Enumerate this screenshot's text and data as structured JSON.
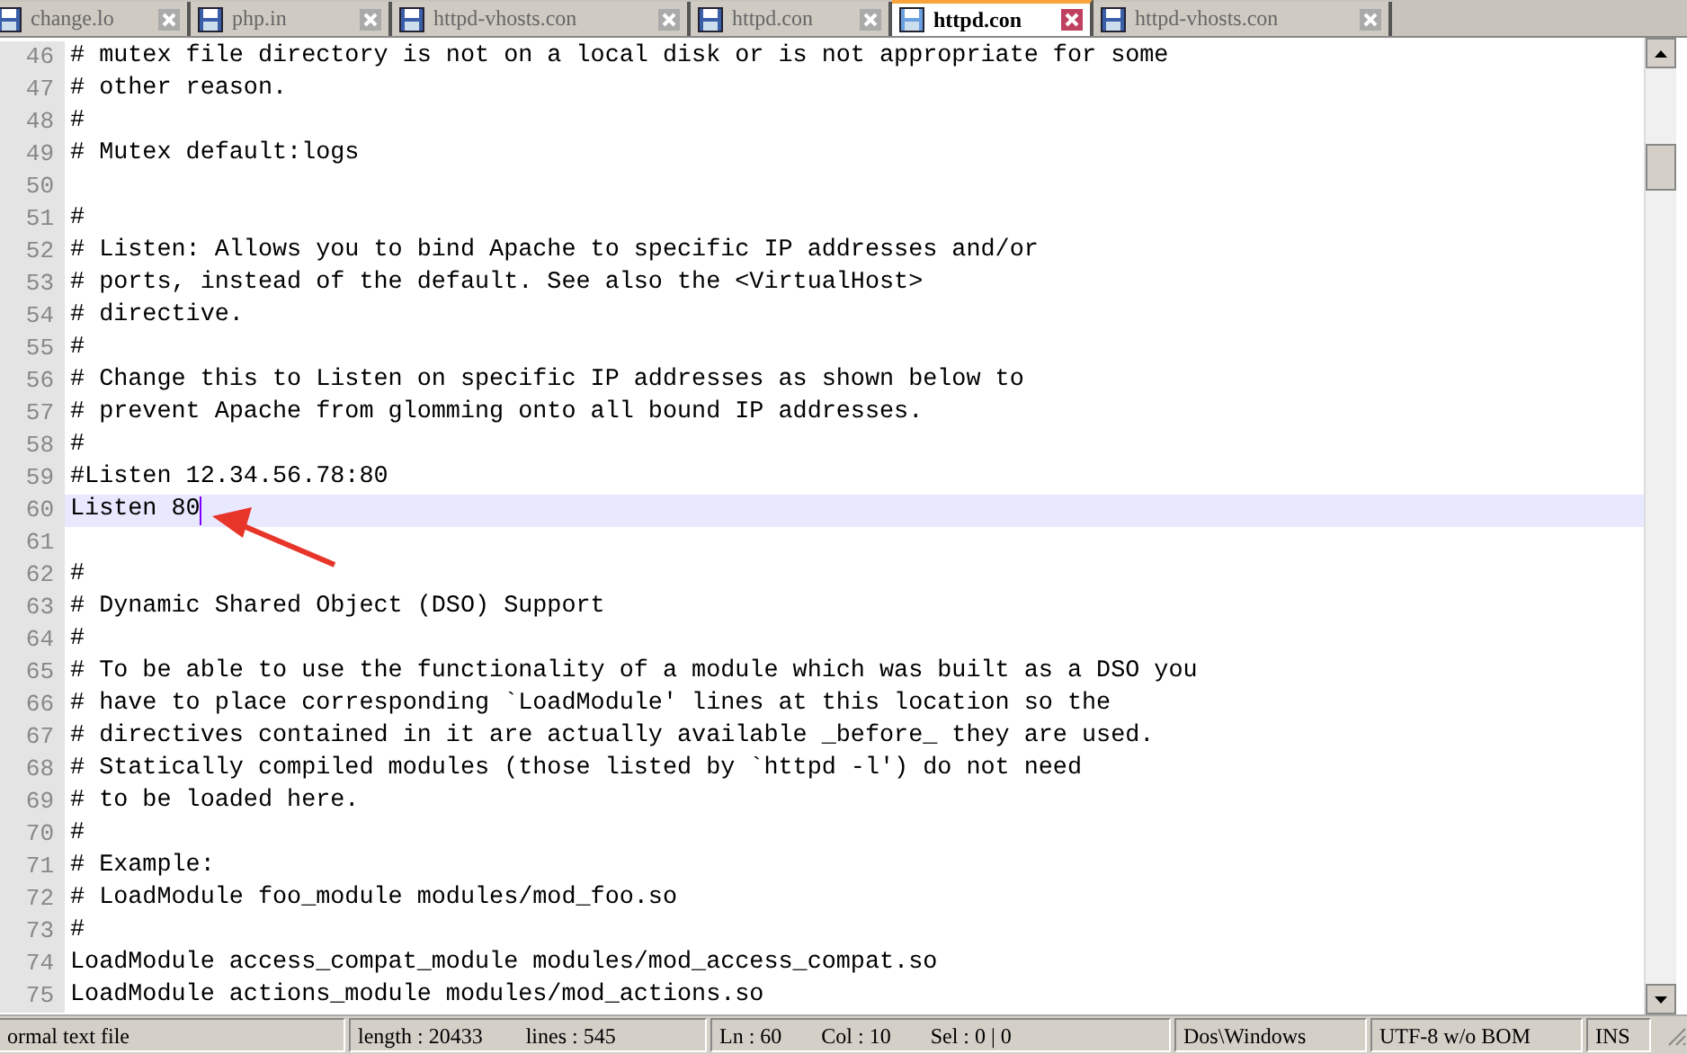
{
  "tabs": [
    {
      "label": "change.lo",
      "selected": false
    },
    {
      "label": "php.in",
      "selected": false
    },
    {
      "label": "httpd-vhosts.con",
      "selected": false
    },
    {
      "label": "httpd.con",
      "selected": false
    },
    {
      "label": "httpd.con",
      "selected": true
    },
    {
      "label": "httpd-vhosts.con",
      "selected": false
    }
  ],
  "editor": {
    "lines": [
      {
        "number": "46",
        "text": "# mutex file directory is not on a local disk or is not appropriate for some",
        "current": false
      },
      {
        "number": "47",
        "text": "# other reason.",
        "current": false
      },
      {
        "number": "48",
        "text": "#",
        "current": false
      },
      {
        "number": "49",
        "text": "# Mutex default:logs",
        "current": false
      },
      {
        "number": "50",
        "current": false
      },
      {
        "number": "51",
        "text": "#",
        "current": false
      },
      {
        "number": "52",
        "text": "# Listen: Allows you to bind Apache to specific IP addresses and/or",
        "current": false
      },
      {
        "number": "53",
        "text": "# ports, instead of the default. See also the <VirtualHost>",
        "current": false
      },
      {
        "number": "54",
        "text": "# directive.",
        "current": false
      },
      {
        "number": "55",
        "text": "#",
        "current": false
      },
      {
        "number": "56",
        "text": "# Change this to Listen on specific IP addresses as shown below to",
        "current": false
      },
      {
        "number": "57",
        "text": "# prevent Apache from glomming onto all bound IP addresses.",
        "current": false
      },
      {
        "number": "58",
        "text": "#",
        "current": false
      },
      {
        "number": "59",
        "text": "#Listen 12.34.56.78:80",
        "current": false
      },
      {
        "number": "60",
        "text": "Listen 80",
        "current": true
      },
      {
        "number": "61",
        "current": false
      },
      {
        "number": "62",
        "text": "#",
        "current": false
      },
      {
        "number": "63",
        "text": "# Dynamic Shared Object (DSO) Support",
        "current": false
      },
      {
        "number": "64",
        "text": "#",
        "current": false
      },
      {
        "number": "65",
        "text": "# To be able to use the functionality of a module which was built as a DSO you",
        "current": false
      },
      {
        "number": "66",
        "text": "# have to place corresponding `LoadModule' lines at this location so the",
        "current": false
      },
      {
        "number": "67",
        "text": "# directives contained in it are actually available _before_ they are used.",
        "current": false
      },
      {
        "number": "68",
        "text": "# Statically compiled modules (those listed by `httpd -l') do not need",
        "current": false
      },
      {
        "number": "69",
        "text": "# to be loaded here.",
        "current": false
      },
      {
        "number": "70",
        "text": "#",
        "current": false
      },
      {
        "number": "71",
        "text": "# Example:",
        "current": false
      },
      {
        "number": "72",
        "text": "# LoadModule foo_module modules/mod_foo.so",
        "current": false
      },
      {
        "number": "73",
        "text": "#",
        "current": false
      },
      {
        "number": "74",
        "text": "LoadModule access_compat_module modules/mod_access_compat.so",
        "current": false
      },
      {
        "number": "75",
        "text": "LoadModule actions_module modules/mod_actions.so",
        "current": false
      }
    ]
  },
  "status_bar": {
    "file_type": "ormal text file",
    "length": "length : 20433",
    "lines": "lines : 545",
    "ln": "Ln : 60",
    "col": "Col : 10",
    "sel": "Sel : 0 | 0",
    "eol": "Dos\\Windows",
    "encoding": "UTF-8 w/o BOM",
    "mode": "INS"
  }
}
